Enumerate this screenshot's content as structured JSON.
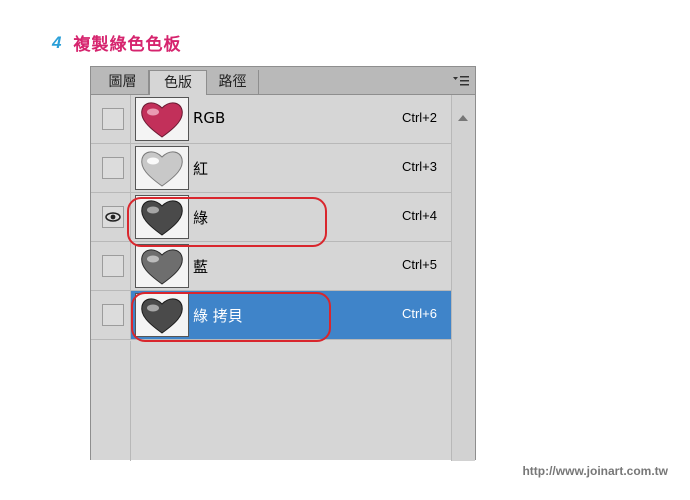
{
  "step": {
    "number": "4",
    "title": "複製綠色色板"
  },
  "panel": {
    "tabs": [
      {
        "label": "圖層",
        "active": false
      },
      {
        "label": "色版",
        "active": true
      },
      {
        "label": "路徑",
        "active": false
      }
    ],
    "menu_icon": "panel-menu-icon",
    "channels": [
      {
        "name": "RGB",
        "shortcut": "Ctrl+2",
        "visible": false,
        "selected": false,
        "thumb_color": "#c2305a"
      },
      {
        "name": "紅",
        "shortcut": "Ctrl+3",
        "visible": false,
        "selected": false,
        "thumb_color": "#c4c4c4"
      },
      {
        "name": "綠",
        "shortcut": "Ctrl+4",
        "visible": true,
        "selected": false,
        "thumb_color": "#4a4a4a"
      },
      {
        "name": "藍",
        "shortcut": "Ctrl+5",
        "visible": false,
        "selected": false,
        "thumb_color": "#6e6e6e"
      },
      {
        "name": "綠 拷貝",
        "shortcut": "Ctrl+6",
        "visible": false,
        "selected": true,
        "thumb_color": "#4a4a4a"
      }
    ]
  },
  "colors": {
    "accent": "#d6246e",
    "step_number": "#2a9fd8",
    "selection": "#3f84c9",
    "highlight": "#d9262d"
  },
  "watermark": "http://www.joinart.com.tw"
}
